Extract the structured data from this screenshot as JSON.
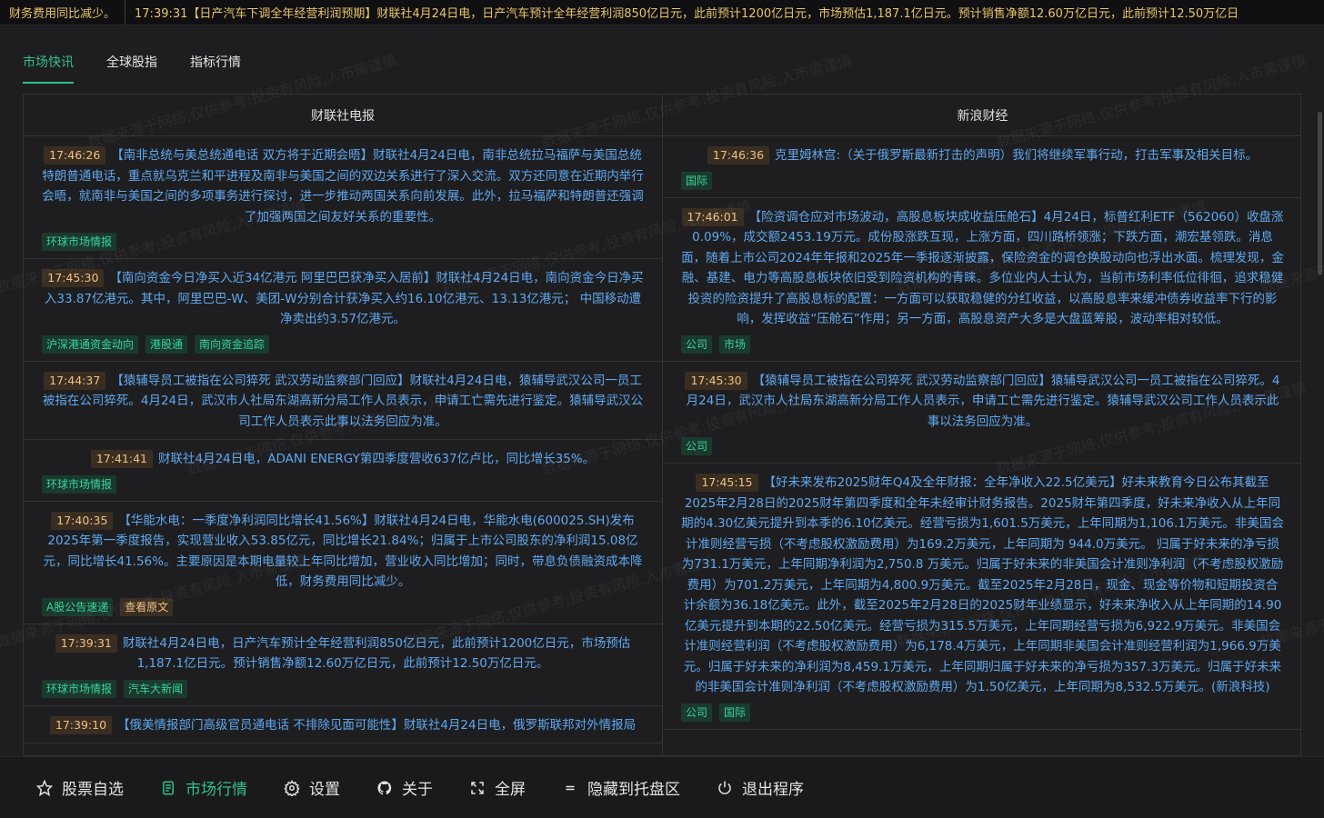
{
  "ticker": {
    "left": "财务费用同比减少。",
    "main": "17:39:31【日产汽车下调全年经营利润预期】财联社4月24日电，日产汽车预计全年经营利润850亿日元，此前预计1200亿日元，市场预估1,187.1亿日元。预计销售净额12.60万亿日元，此前预计12.50万亿日"
  },
  "tabs": [
    {
      "label": "市场快讯"
    },
    {
      "label": "全球股指"
    },
    {
      "label": "指标行情"
    }
  ],
  "columns": {
    "left_title": "财联社电报",
    "right_title": "新浪财经"
  },
  "left_news": [
    {
      "time": "17:46:26",
      "text": "【南非总统与美总统通电话 双方将于近期会晤】财联社4月24日电，南非总统拉马福萨与美国总统特朗普通电话，重点就乌克兰和平进程及南非与美国之间的双边关系进行了深入交流。双方还同意在近期内举行会晤，就南非与美国之间的多项事务进行探讨，进一步推动两国关系向前发展。此外，拉马福萨和特朗普还强调了加强两国之间友好关系的重要性。",
      "tags": [
        "环球市场情报"
      ]
    },
    {
      "time": "17:45:30",
      "text": "【南向资金今日净买入近34亿港元 阿里巴巴获净买入居前】财联社4月24日电，南向资金今日净买入33.87亿港元。其中，阿里巴巴-W、美团-W分别合计获净买入约16.10亿港元、13.13亿港元； 中国移动遭净卖出约3.57亿港元。",
      "tags": [
        "沪深港通资金动向",
        "港股通",
        "南向资金追踪"
      ]
    },
    {
      "time": "17:44:37",
      "text": "【猿辅导员工被指在公司猝死 武汉劳动监察部门回应】财联社4月24日电，猿辅导武汉公司一员工被指在公司猝死。4月24日，武汉市人社局东湖高新分局工作人员表示，申请工亡需先进行鉴定。猿辅导武汉公司工作人员表示此事以法务回应为准。",
      "tags": []
    },
    {
      "time": "17:41:41",
      "text": "财联社4月24日电，ADANI ENERGY第四季度营收637亿卢比，同比增长35%。",
      "tags": [
        "环球市场情报"
      ]
    },
    {
      "time": "17:40:35",
      "text": "【华能水电：一季度净利润同比增长41.56%】财联社4月24日电，华能水电(600025.SH)发布2025年第一季度报告，实现营业收入53.85亿元，同比增长21.84%；归属于上市公司股东的净利润15.08亿元，同比增长41.56%。主要原因是本期电量较上年同比增加，营业收入同比增加；同时，带息负债融资成本降低，财务费用同比减少。",
      "tags": [
        "A股公告速递"
      ],
      "warn_tag": "查看原文"
    },
    {
      "time": "17:39:31",
      "text": "财联社4月24日电，日产汽车预计全年经营利润850亿日元，此前预计1200亿日元，市场预估1,187.1亿日元。预计销售净额12.60万亿日元，此前预计12.50万亿日元。",
      "tags": [
        "环球市场情报",
        "汽车大新闻"
      ]
    },
    {
      "time": "17:39:10",
      "text": "【俄美情报部门高级官员通电话 不排除见面可能性】财联社4月24日电，俄罗斯联邦对外情报局",
      "tags": []
    }
  ],
  "right_news": [
    {
      "time": "17:46:36",
      "text": "克里姆林宫:（关于俄罗斯最新打击的声明）我们将继续军事行动，打击军事及相关目标。",
      "tags": [
        "国际"
      ]
    },
    {
      "time": "17:46:01",
      "text": "【险资调仓应对市场波动，高股息板块成收益压舱石】4月24日，标普红利ETF（562060）收盘涨0.09%，成交额2453.19万元。成份股涨跌互现，上涨方面，四川路桥领涨；下跌方面，潮宏基领跌。消息面，随着上市公司2024年年报和2025年一季报逐渐披露，保险资金的调仓换股动向也浮出水面。梳理发现，金融、基建、电力等高股息板块依旧受到险资机构的青睐。多位业内人士认为，当前市场利率低位徘徊，追求稳健投资的险资提升了高股息标的配置：一方面可以获取稳健的分红收益，以高股息率来缓冲债券收益率下行的影响，发挥收益“压舱石”作用；另一方面，高股息资产大多是大盘蓝筹股，波动率相对较低。",
      "tags": [
        "公司",
        "市场"
      ]
    },
    {
      "time": "17:45:30",
      "text": "【猿辅导员工被指在公司猝死 武汉劳动监察部门回应】猿辅导武汉公司一员工被指在公司猝死。4月24日，武汉市人社局东湖高新分局工作人员表示，申请工亡需先进行鉴定。猿辅导武汉公司工作人员表示此事以法务回应为准。",
      "tags": [
        "公司"
      ]
    },
    {
      "time": "17:45:15",
      "text": "【好未来发布2025财年Q4及全年财报：全年净收入22.5亿美元】好未来教育今日公布其截至2025年2月28日的2025财年第四季度和全年未经审计财务报告。2025财年第四季度，好未来净收入从上年同期的4.30亿美元提升到本季的6.10亿美元。经营亏损为1,601.5万美元，上年同期为1,106.1万美元。非美国会计准则经营亏损（不考虑股权激励费用）为169.2万美元，上年同期为 944.0万美元。 归属于好未来的净亏损为731.1万美元，上年同期净利润为2,750.8 万美元。归属于好未来的非美国会计准则净利润（不考虑股权激励费用）为701.2万美元，上年同期为4,800.9万美元。截至2025年2月28日，现金、现金等价物和短期投资合计余额为36.18亿美元。此外，截至2025年2月28日的2025财年业绩显示，好未来净收入从上年同期的14.90亿美元提升到本期的22.50亿美元。经营亏损为315.5万美元，上年同期经营亏损为6,922.9万美元。非美国会计准则经营利润（不考虑股权激励费用）为6,178.4万美元，上年同期非美国会计准则经营利润为1,966.9万美元。归属于好未来的净利润为8,459.1万美元，上年同期归属于好未来的净亏损为357.3万美元。归属于好未来的非美国会计准则净利润（不考虑股权激励费用）为1.50亿美元，上年同期为8,532.5万美元。(新浪科技)",
      "tags": [
        "公司",
        "国际"
      ]
    }
  ],
  "watermark": "数据来源于网络,仅供参考;投资有风险,入市需谨慎",
  "footer": [
    {
      "label": "股票自选",
      "icon": "star-icon"
    },
    {
      "label": "市场行情",
      "icon": "document-icon"
    },
    {
      "label": "设置",
      "icon": "gear-icon"
    },
    {
      "label": "关于",
      "icon": "github-icon"
    },
    {
      "label": "全屏",
      "icon": "fullscreen-icon"
    },
    {
      "label": "隐藏到托盘区",
      "icon": "minimize-icon"
    },
    {
      "label": "退出程序",
      "icon": "power-icon"
    }
  ],
  "colors": {
    "accent": "#30c08a",
    "news_text": "#5fa8f0",
    "time_badge": "#f0c080"
  }
}
